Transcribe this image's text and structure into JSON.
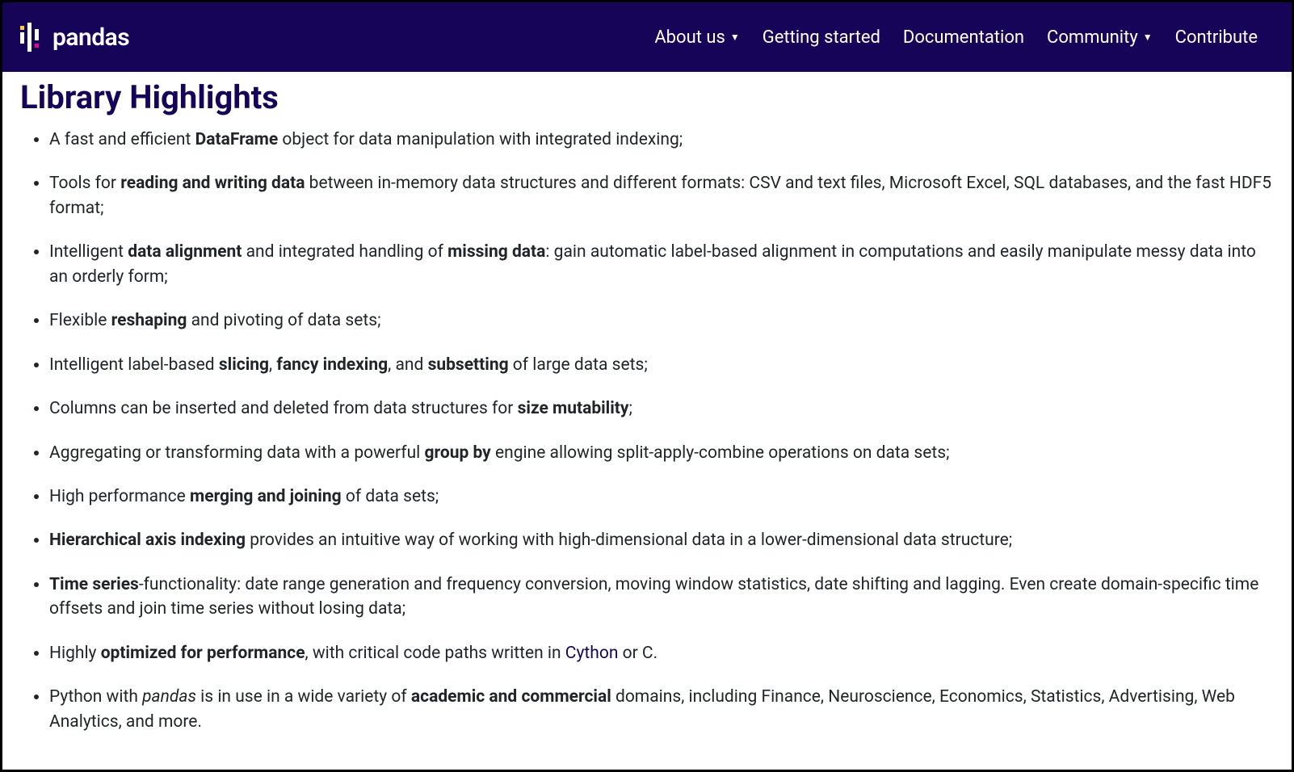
{
  "brand": {
    "name": "pandas"
  },
  "nav": {
    "about": "About us",
    "getting_started": "Getting started",
    "documentation": "Documentation",
    "community": "Community",
    "contribute": "Contribute"
  },
  "page": {
    "title": "Library Highlights",
    "highlights": [
      "A fast and efficient <b>DataFrame</b> object for data manipulation with integrated indexing;",
      "Tools for <b>reading and writing data</b> between in-memory data structures and different formats: CSV and text files, Microsoft Excel, SQL databases, and the fast HDF5 format;",
      "Intelligent <b>data alignment</b> and integrated handling of <b>missing data</b>: gain automatic label-based alignment in computations and easily manipulate messy data into an orderly form;",
      "Flexible <b>reshaping</b> and pivoting of data sets;",
      "Intelligent label-based <b>slicing</b>, <b>fancy indexing</b>, and <b>subsetting</b> of large data sets;",
      "Columns can be inserted and deleted from data structures for <b>size mutability</b>;",
      "Aggregating or transforming data with a powerful <b>group by</b> engine allowing split-apply-combine operations on data sets;",
      "High performance <b>merging and joining</b> of data sets;",
      "<b>Hierarchical axis indexing</b> provides an intuitive way of working with high-dimensional data in a lower-dimensional data structure;",
      "<b>Time series</b>-functionality: date range generation and frequency conversion, moving window statistics, date shifting and lagging. Even create domain-specific time offsets and join time series without losing data;",
      "Highly <b>optimized for performance</b>, with critical code paths written in <a>Cython</a> or C.",
      "Python with <em>pandas</em> is in use in a wide variety of <b>academic and commercial</b> domains, including Finance, Neuroscience, Economics, Statistics, Advertising, Web Analytics, and more."
    ]
  }
}
